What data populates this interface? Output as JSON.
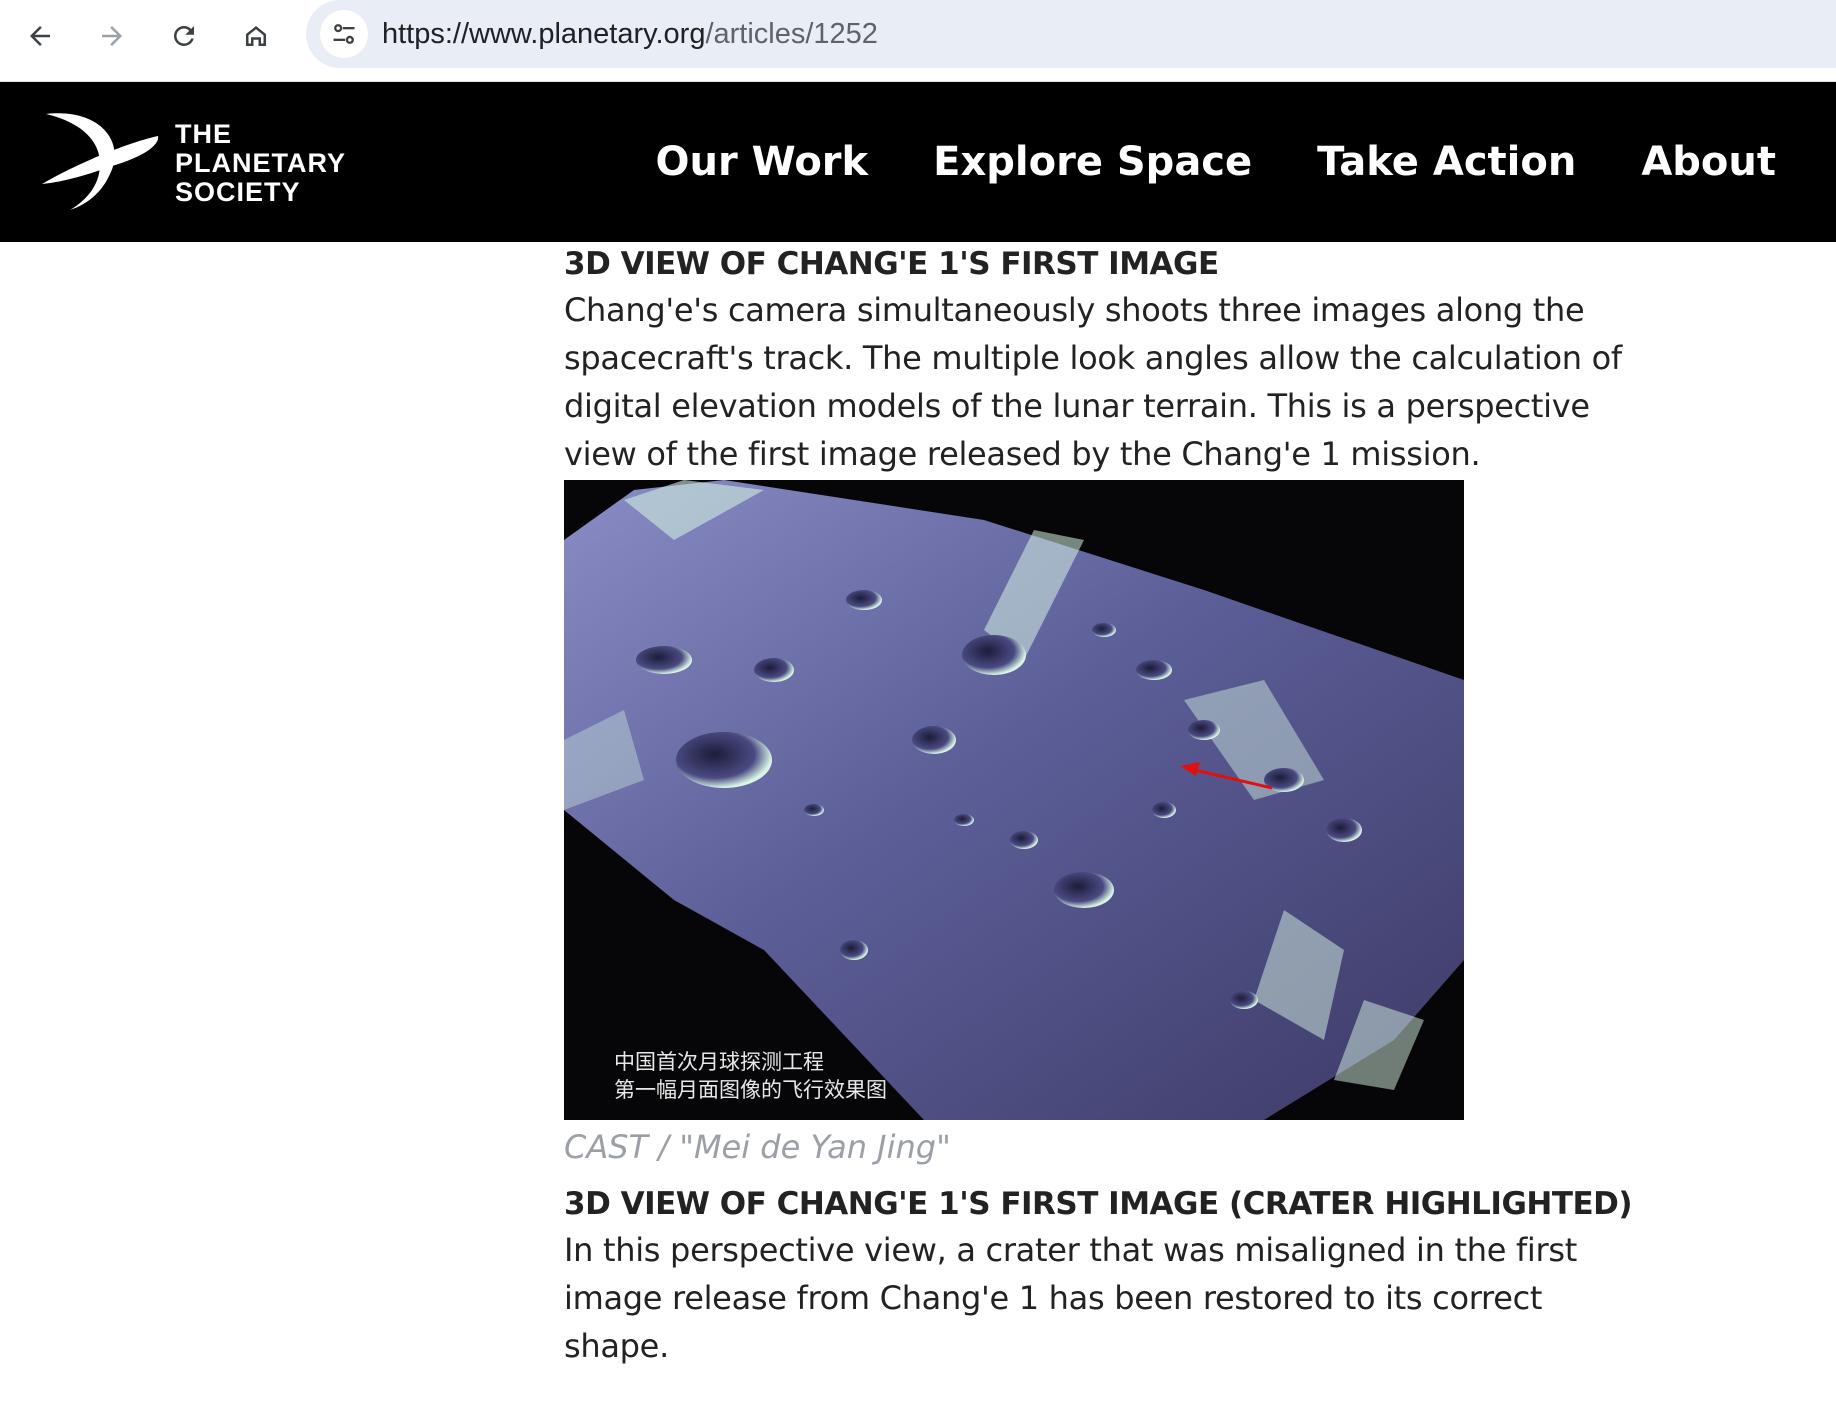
{
  "browser": {
    "back_icon": "arrow-left-icon",
    "forward_icon": "arrow-right-icon",
    "reload_icon": "reload-icon",
    "home_icon": "home-icon",
    "site_info_icon": "tune-icon",
    "url_host": "https://www.planetary.org",
    "url_path": "/articles/1252"
  },
  "site": {
    "logo_lines": [
      "THE",
      "PLANETARY",
      "SOCIETY"
    ],
    "nav": [
      "Our Work",
      "Explore Space",
      "Take Action",
      "About"
    ]
  },
  "article": {
    "items": [
      {
        "title": "3D VIEW OF CHANG'E 1'S FIRST IMAGE",
        "description": "Chang'e's camera simultaneously shoots three images along the spacecraft's track. The multiple look angles allow the calculation of digital elevation models of the lunar terrain. This is a perspective view of the first image released by the Chang'e 1 mission.",
        "image_caption_lines": [
          "中国首次月球探测工程",
          "第一幅月面图像的飞行效果图"
        ],
        "credit": "CAST / \"Mei de Yan Jing\""
      },
      {
        "title": "3D VIEW OF CHANG'E 1'S FIRST IMAGE (CRATER HIGHLIGHTED)",
        "description": "In this perspective view, a crater that was misaligned in the first image release from Chang'e 1 has been restored to its correct shape."
      }
    ]
  },
  "colors": {
    "header_bg": "#000000",
    "text": "#222222",
    "credit": "#9aa0a6",
    "omnibox": "#e9edf5"
  }
}
